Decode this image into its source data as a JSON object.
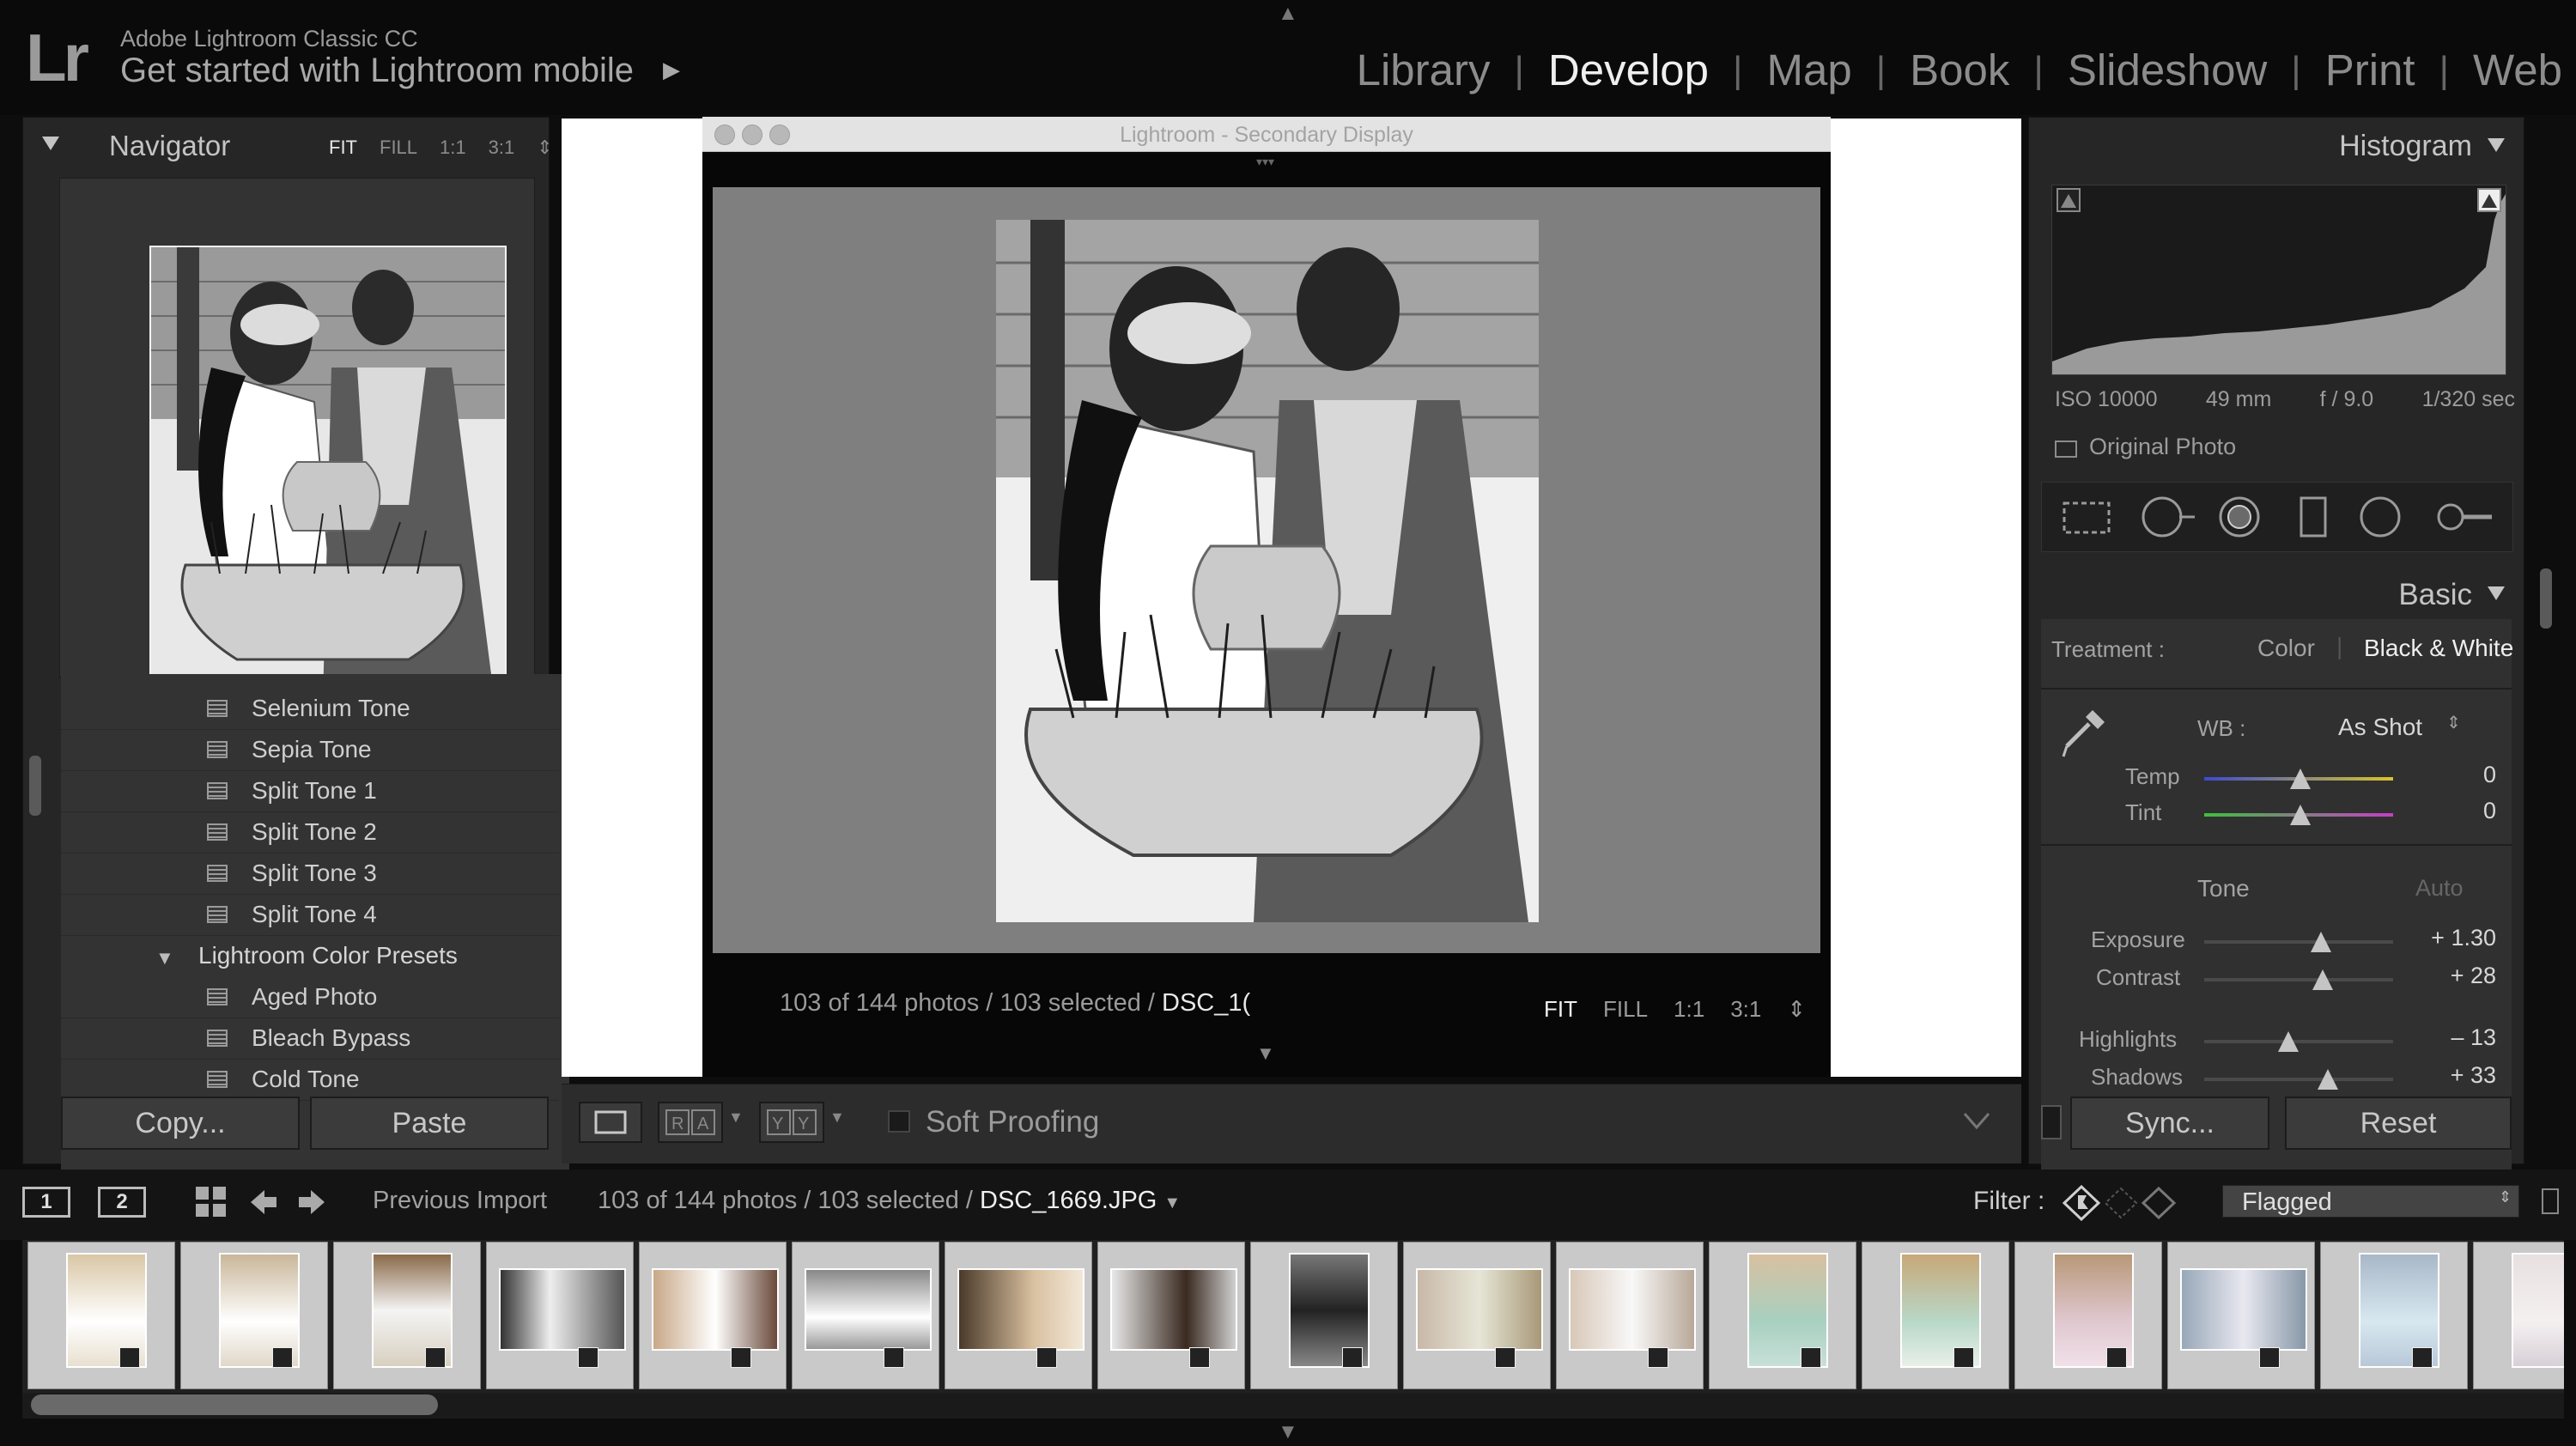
{
  "identity": {
    "logo": "Lr",
    "app_name": "Adobe Lightroom Classic CC",
    "mobile_promo": "Get started with Lightroom mobile",
    "promo_arrow": "▶"
  },
  "modules": [
    "Library",
    "Develop",
    "Map",
    "Book",
    "Slideshow",
    "Print",
    "Web"
  ],
  "active_module": "Develop",
  "navigator": {
    "title": "Navigator",
    "zoom_options": [
      "FIT",
      "FILL",
      "1:1",
      "3:1"
    ],
    "selected_zoom": "FIT"
  },
  "presets": {
    "items": [
      {
        "label": "Selenium Tone",
        "type": "preset"
      },
      {
        "label": "Sepia Tone",
        "type": "preset"
      },
      {
        "label": "Split Tone 1",
        "type": "preset"
      },
      {
        "label": "Split Tone 2",
        "type": "preset"
      },
      {
        "label": "Split Tone 3",
        "type": "preset"
      },
      {
        "label": "Split Tone 4",
        "type": "preset"
      },
      {
        "label": "Lightroom Color Presets",
        "type": "folder"
      },
      {
        "label": "Aged Photo",
        "type": "preset"
      },
      {
        "label": "Bleach Bypass",
        "type": "preset"
      },
      {
        "label": "Cold Tone",
        "type": "preset"
      }
    ]
  },
  "left_buttons": {
    "copy": "Copy...",
    "paste": "Paste"
  },
  "secondary_display": {
    "title": "Lightroom - Secondary Display",
    "status_prefix": "103 of 144 photos / 103 selected /",
    "status_file": "DSC_1(",
    "zoom_options": [
      "FIT",
      "FILL",
      "1:1",
      "3:1"
    ],
    "selected_zoom": "FIT"
  },
  "toolbar": {
    "soft_proofing_label": "Soft Proofing",
    "soft_proofing_checked": false
  },
  "histogram": {
    "title": "Histogram",
    "iso": "ISO 10000",
    "focal_length": "49 mm",
    "aperture": "f / 9.0",
    "shutter": "1/320 sec",
    "original_photo_label": "Original Photo"
  },
  "basic": {
    "title": "Basic",
    "treatment_label": "Treatment :",
    "treatment_color": "Color",
    "treatment_bw": "Black & White",
    "treatment_selected": "Black & White",
    "wb_label": "WB :",
    "wb_value": "As Shot",
    "temp_label": "Temp",
    "temp_value": "0",
    "tint_label": "Tint",
    "tint_value": "0",
    "tone_label": "Tone",
    "auto_label": "Auto",
    "exposure_label": "Exposure",
    "exposure_value": "+ 1.30",
    "contrast_label": "Contrast",
    "contrast_value": "+ 28",
    "highlights_label": "Highlights",
    "highlights_value": "– 13",
    "shadows_label": "Shadows",
    "shadows_value": "+ 33"
  },
  "right_buttons": {
    "sync": "Sync...",
    "reset": "Reset"
  },
  "filmstrip": {
    "monitor_1": "1",
    "monitor_2": "2",
    "source": "Previous Import",
    "count_prefix": "103 of 144 photos / 103 selected /",
    "current_file": "DSC_1669.JPG",
    "filter_label": "Filter :",
    "filter_value": "Flagged",
    "thumbnail_count": 17
  },
  "colors": {
    "background": "#0d0d0d",
    "panel": "#262626",
    "active_text": "#efefef",
    "inactive_text": "#8c8c8c",
    "secondary_canvas": "#7f7f7f"
  }
}
